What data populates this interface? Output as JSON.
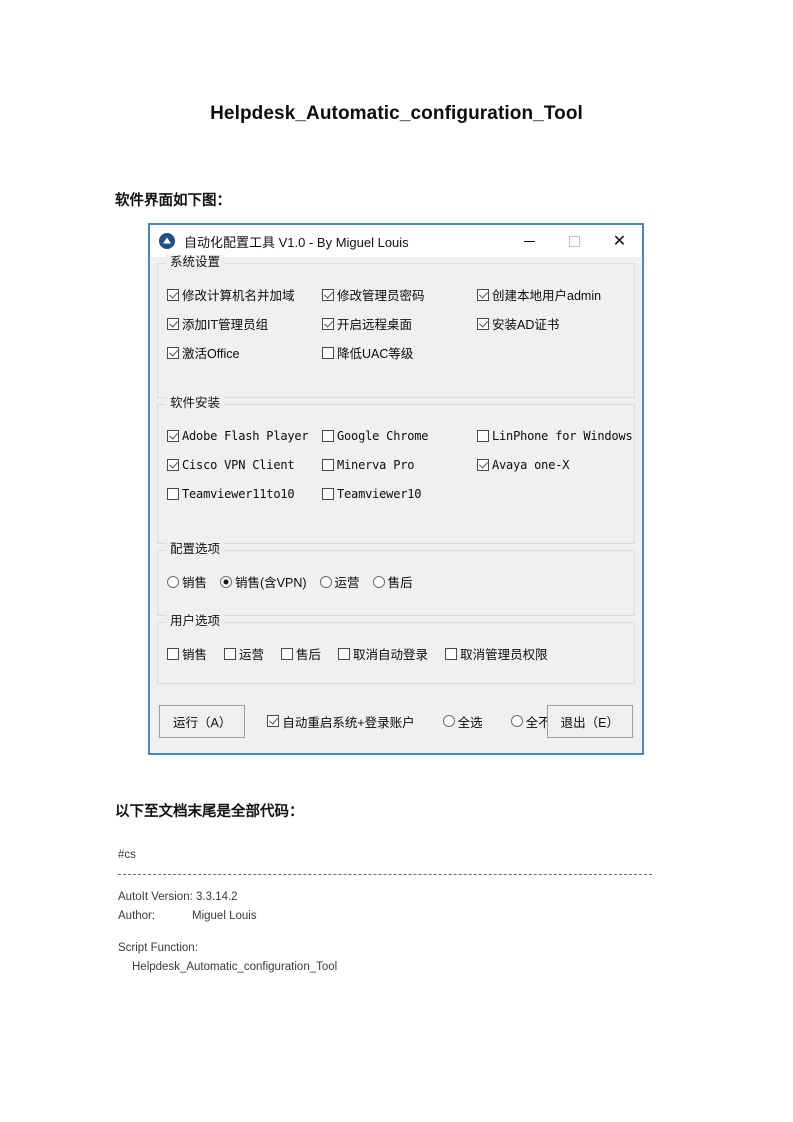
{
  "document": {
    "title": "Helpdesk_Automatic_configuration_Tool",
    "heading_ui": "软件界面如下图：",
    "heading_code": "以下至文档末尾是全部代码：",
    "code": {
      "directive": "#cs",
      "version_label": "AutoIt Version:",
      "version_value": "3.3.14.2",
      "author_label": "Author:",
      "author_value": "Miguel Louis",
      "function_label": "Script Function:",
      "function_value": "Helpdesk_Automatic_configuration_Tool"
    }
  },
  "window": {
    "title": "自动化配置工具 V1.0  - By Miguel Louis",
    "icon": "autoit-logo-icon",
    "border_color": "#4a86c5",
    "controls": {
      "minimize": "minimize-icon",
      "maximize": "maximize-icon",
      "close": "✕"
    },
    "groups": {
      "system": {
        "title": "系统设置",
        "items": [
          {
            "label": "修改计算机名并加域",
            "checked": true
          },
          {
            "label": "修改管理员密码",
            "checked": true
          },
          {
            "label": "创建本地用户admin",
            "checked": true
          },
          {
            "label": "添加IT管理员组",
            "checked": true
          },
          {
            "label": "开启远程桌面",
            "checked": true
          },
          {
            "label": "安装AD证书",
            "checked": true
          },
          {
            "label": "激活Office",
            "checked": true
          },
          {
            "label": "降低UAC等级",
            "checked": false
          }
        ]
      },
      "software": {
        "title": "软件安装",
        "items": [
          {
            "label": "Adobe Flash Player",
            "checked": true
          },
          {
            "label": "Google Chrome",
            "checked": false
          },
          {
            "label": "LinPhone for Windows",
            "checked": false
          },
          {
            "label": "Cisco VPN Client",
            "checked": true
          },
          {
            "label": "Minerva Pro",
            "checked": false
          },
          {
            "label": "Avaya one-X",
            "checked": true
          },
          {
            "label": "Teamviewer11to10",
            "checked": false
          },
          {
            "label": "Teamviewer10",
            "checked": false
          }
        ]
      },
      "config": {
        "title": "配置选项",
        "items": [
          {
            "label": "销售",
            "checked": false
          },
          {
            "label": "销售(含VPN)",
            "checked": true
          },
          {
            "label": "运营",
            "checked": false
          },
          {
            "label": "售后",
            "checked": false
          }
        ]
      },
      "user": {
        "title": "用户选项",
        "items": [
          {
            "label": "销售",
            "checked": false
          },
          {
            "label": "运营",
            "checked": false
          },
          {
            "label": "售后",
            "checked": false
          },
          {
            "label": "取消自动登录",
            "checked": false
          },
          {
            "label": "取消管理员权限",
            "checked": false
          }
        ]
      }
    },
    "footer": {
      "run_button": "运行（A）",
      "exit_button": "退出（E）",
      "auto_restart": {
        "label": "自动重启系统+登录账户",
        "checked": true
      },
      "select_all": {
        "label": "全选",
        "checked": false
      },
      "select_none": {
        "label": "全不选",
        "checked": false
      }
    }
  }
}
